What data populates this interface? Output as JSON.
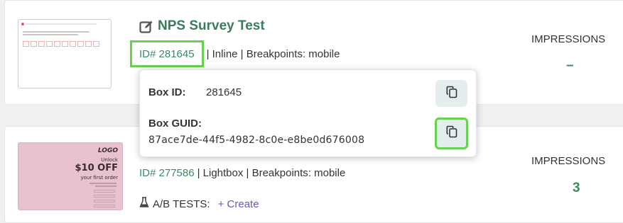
{
  "cards": [
    {
      "title": "NPS Survey Test",
      "id_text": "ID# 281645",
      "meta_text": "| Inline | Breakpoints: mobile",
      "impressions_label": "IMPRESSIONS",
      "impressions_value": "–"
    },
    {
      "thumb": {
        "logo": "LOGO",
        "unlock": "Unlock",
        "offer": "$10 OFF",
        "subtitle": "your first order"
      },
      "id_text": "ID# 277586",
      "meta_text": "| Lightbox | Breakpoints: mobile",
      "impressions_label": "IMPRESSIONS",
      "impressions_value": "3",
      "ab_tests_label": "A/B TESTS:",
      "create_label": "+ Create"
    }
  ],
  "popover": {
    "box_id_label": "Box ID:",
    "box_id_value": "281645",
    "box_guid_label": "Box GUID:",
    "box_guid_value": "87ace7de-44f5-4982-8c0e-e8be0d676008"
  },
  "colors": {
    "accent_green": "#3a8a63",
    "highlight_green": "#68d14f",
    "link_purple": "#6a5aa8"
  },
  "icons": [
    "edit-icon",
    "copy-icon",
    "flask-icon"
  ]
}
